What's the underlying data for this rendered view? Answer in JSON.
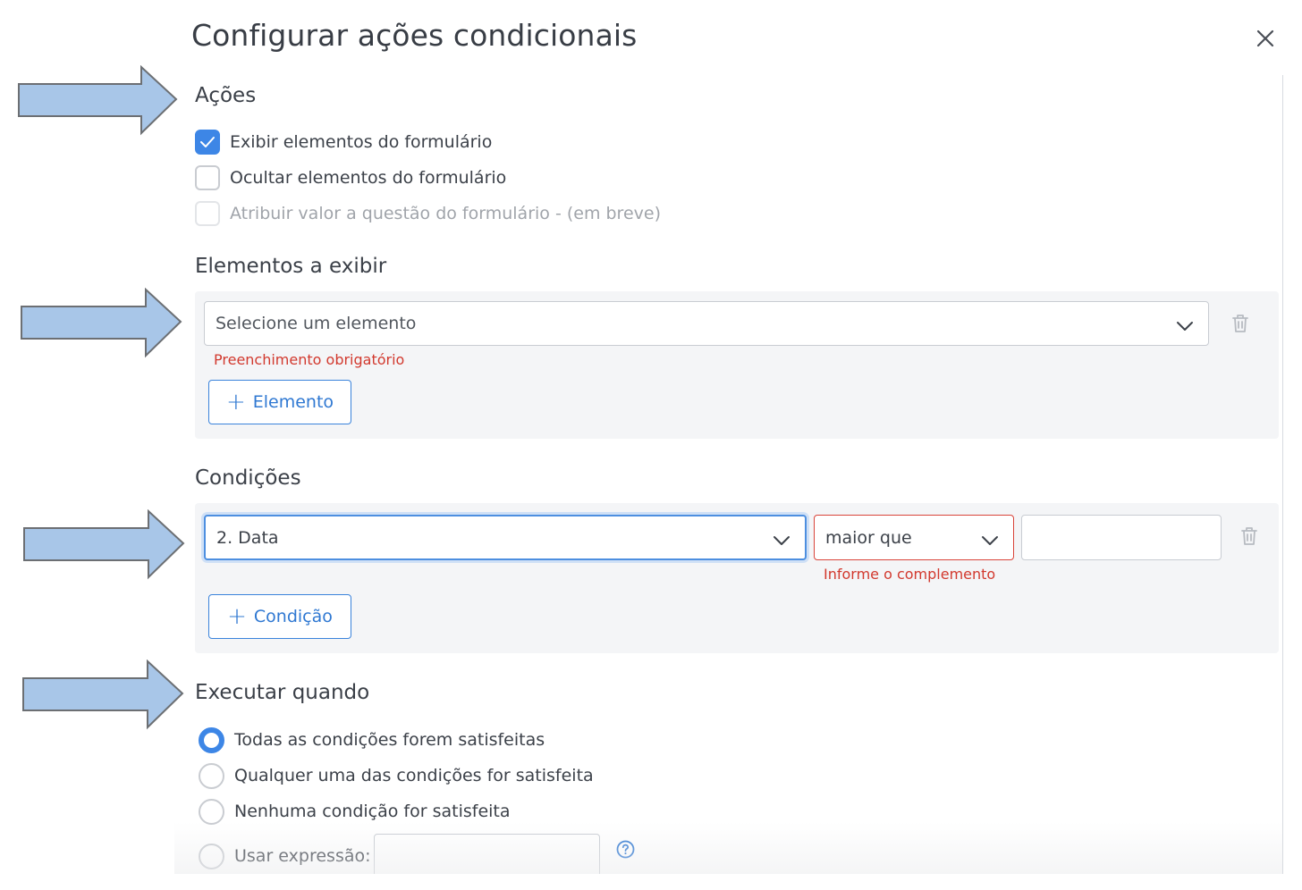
{
  "dialog": {
    "title": "Configurar ações condicionais",
    "close_icon": "close-icon"
  },
  "acoes": {
    "title": "Ações",
    "options": [
      {
        "label": "Exibir elementos do formulário",
        "checked": true,
        "disabled": false
      },
      {
        "label": "Ocultar elementos do formulário",
        "checked": false,
        "disabled": false
      },
      {
        "label": "Atribuir valor a questão do formulário - (em breve)",
        "checked": false,
        "disabled": true
      }
    ]
  },
  "elementos": {
    "title": "Elementos a exibir",
    "select_placeholder": "Selecione um elemento",
    "error": "Preenchimento obrigatório",
    "add_button": "Elemento",
    "add_icon": "plus-icon",
    "delete_icon": "trash-icon"
  },
  "condicoes": {
    "title": "Condições",
    "field_value": "2. Data",
    "operator_value": "maior que",
    "complement_value": "",
    "error": "Informe o complemento",
    "add_button": "Condição",
    "add_icon": "plus-icon",
    "delete_icon": "trash-icon"
  },
  "executar": {
    "title": "Executar quando",
    "options": [
      {
        "label": "Todas as condições forem satisfeitas",
        "selected": true
      },
      {
        "label": "Qualquer uma das condições for satisfeita",
        "selected": false
      },
      {
        "label": "Nenhuma condição for satisfeita",
        "selected": false
      },
      {
        "label": "Usar expressão:",
        "selected": false
      }
    ],
    "expression_value": "",
    "help_icon": "help-icon"
  },
  "annotations": {
    "arrow_icon": "right-arrow-icon",
    "arrow_fill": "#a8c6e8",
    "arrow_stroke": "#6c6f73"
  },
  "colors": {
    "accent": "#3d86e6",
    "error": "#d2392e",
    "panel_bg": "#f4f5f7"
  }
}
